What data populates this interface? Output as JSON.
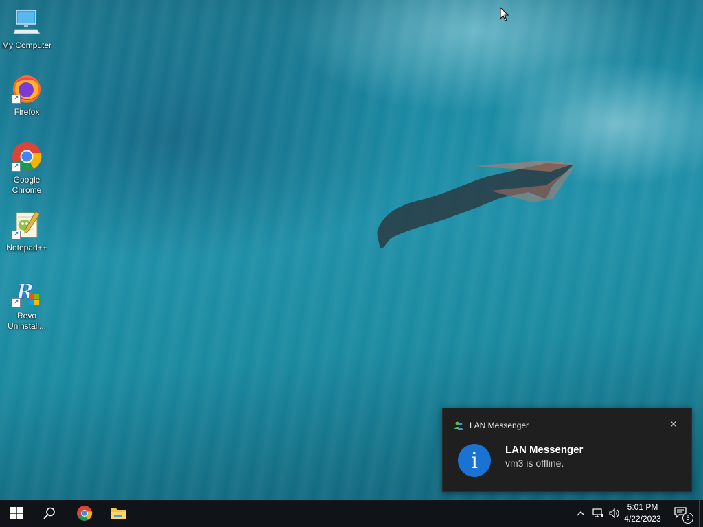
{
  "desktop": {
    "icons": [
      {
        "label": "My Computer",
        "icon": "computer-icon",
        "shortcut": false
      },
      {
        "label": "Firefox",
        "icon": "firefox-icon",
        "shortcut": true
      },
      {
        "label": "Google Chrome",
        "icon": "chrome-icon",
        "shortcut": true
      },
      {
        "label": "Notepad++",
        "icon": "notepadpp-icon",
        "shortcut": true
      },
      {
        "label": "Revo Uninstall...",
        "icon": "revo-uninstaller-icon",
        "shortcut": true
      }
    ],
    "wallpaper": "underwater-diver"
  },
  "toast": {
    "app_name": "LAN Messenger",
    "title": "LAN Messenger",
    "body": "vm3 is offline.",
    "info_glyph": "i",
    "close_glyph": "✕",
    "accent": "#1a73d2"
  },
  "taskbar": {
    "start_icon": "windows-start-icon",
    "search_icon": "search-icon",
    "pinned": [
      "chrome-icon",
      "file-explorer-icon"
    ],
    "tray": {
      "chevron_glyph": "^",
      "network_icon": "network-icon",
      "volume_icon": "volume-icon",
      "time": "5:01 PM",
      "date": "4/22/2023",
      "notification_count": "5"
    }
  }
}
